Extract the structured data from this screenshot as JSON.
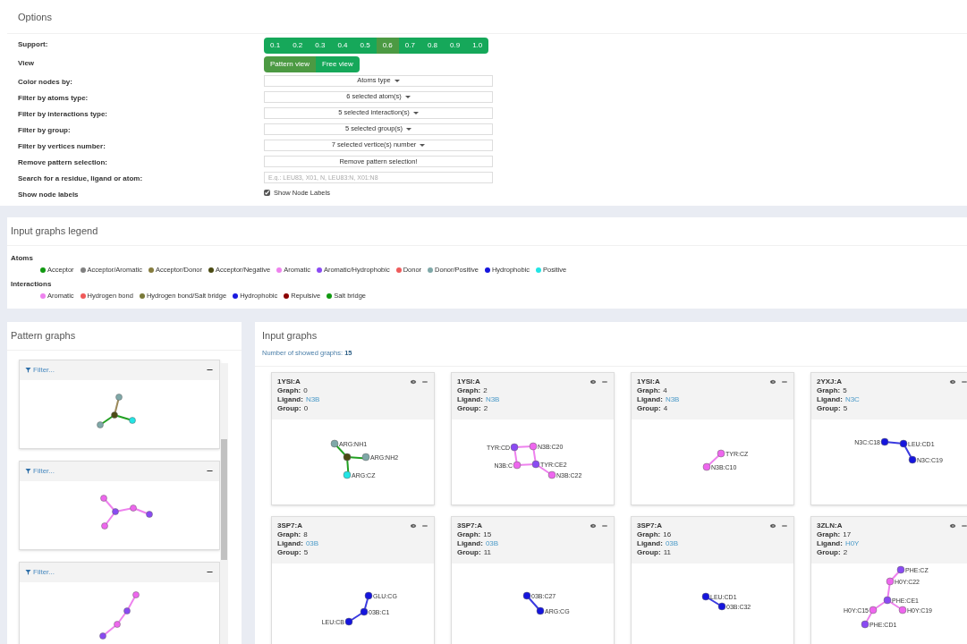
{
  "options": {
    "title": "Options",
    "rows": [
      {
        "label": "Support:",
        "kind": "segmented",
        "choices": [
          {
            "label": "0.1",
            "selected": false
          },
          {
            "label": "0.2",
            "selected": false
          },
          {
            "label": "0.3",
            "selected": false
          },
          {
            "label": "0.4",
            "selected": false
          },
          {
            "label": "0.5",
            "selected": false
          },
          {
            "label": "0.6",
            "selected": true
          },
          {
            "label": "0.7",
            "selected": false
          },
          {
            "label": "0.8",
            "selected": false
          },
          {
            "label": "0.9",
            "selected": false
          },
          {
            "label": "1.0",
            "selected": false
          }
        ]
      },
      {
        "label": "View",
        "kind": "segmented",
        "choices": [
          {
            "label": "Pattern view",
            "selected": true
          },
          {
            "label": "Free view",
            "selected": false
          }
        ]
      },
      {
        "label": "Color nodes by:",
        "kind": "dropdown",
        "value": "Atoms type"
      },
      {
        "label": "Filter by atoms type:",
        "kind": "dropdown",
        "value": "6 selected atom(s)"
      },
      {
        "label": "Filter by interactions type:",
        "kind": "dropdown",
        "value": "5 selected interaction(s)"
      },
      {
        "label": "Filter by group:",
        "kind": "dropdown",
        "value": "5 selected group(s)"
      },
      {
        "label": "Filter by vertices number:",
        "kind": "dropdown",
        "value": "7 selected vertice(s) number"
      },
      {
        "label": "Remove pattern selection:",
        "kind": "button",
        "value": "Remove pattern selection!"
      },
      {
        "label": "Search for a residue, ligand or atom:",
        "kind": "search",
        "placeholder": "E.g.: LEU83, X01, N, LEU83:N, X01:N8"
      },
      {
        "label": "Show node labels",
        "kind": "checkbox",
        "text": "Show Node Labels",
        "checked": true
      }
    ]
  },
  "legend": {
    "title": "Input graphs legend",
    "groups": [
      {
        "title": "Atoms",
        "items": [
          {
            "label": "Acceptor",
            "color": "#119911"
          },
          {
            "label": "Acceptor/Aromatic",
            "color": "#808080"
          },
          {
            "label": "Acceptor/Donor",
            "color": "#857c3e"
          },
          {
            "label": "Acceptor/Negative",
            "color": "#4b4b13"
          },
          {
            "label": "Aromatic",
            "color": "#ee82ee"
          },
          {
            "label": "Aromatic/Hydrophobic",
            "color": "#8a4af3"
          },
          {
            "label": "Donor",
            "color": "#ee5c5c"
          },
          {
            "label": "Donor/Positive",
            "color": "#7fa8a8"
          },
          {
            "label": "Hydrophobic",
            "color": "#1515dd"
          },
          {
            "label": "Positive",
            "color": "#22e5e5"
          }
        ]
      },
      {
        "title": "Interactions",
        "items": [
          {
            "label": "Aromatic",
            "color": "#ee82ee"
          },
          {
            "label": "Hydrogen bond",
            "color": "#f05a5a"
          },
          {
            "label": "Hydrogen bond/Salt bridge",
            "color": "#7a7a3a"
          },
          {
            "label": "Hydrophobic",
            "color": "#1a1ae0"
          },
          {
            "label": "Repulsive",
            "color": "#8b0000"
          },
          {
            "label": "Salt bridge",
            "color": "#119911"
          }
        ]
      }
    ]
  },
  "pattern_graphs": {
    "title": "Pattern graphs",
    "cards": [
      {
        "filter": "Filter...",
        "nodes": [
          {
            "color": "#7fa8a8"
          },
          {
            "color": "#4b4b13"
          },
          {
            "color": "#7fa8a8"
          },
          {
            "color": "#22e5e5"
          }
        ],
        "edges": [
          {
            "color": "#9c8a5a"
          },
          {
            "color": "#22a022"
          },
          {
            "color": "#22a022"
          }
        ]
      },
      {
        "filter": "Filter...",
        "nodes": [
          {
            "color": "#ee66ee"
          },
          {
            "color": "#8a4af3"
          },
          {
            "color": "#ee66ee"
          },
          {
            "color": "#8a4af3"
          },
          {
            "color": "#ee66ee"
          }
        ],
        "edges": [
          {
            "color": "#ee82ee"
          },
          {
            "color": "#ee82ee"
          },
          {
            "color": "#ee82ee"
          },
          {
            "color": "#ee82ee"
          }
        ]
      },
      {
        "filter": "Filter...",
        "nodes": [
          {
            "color": "#ee66ee"
          },
          {
            "color": "#8a4af3"
          },
          {
            "color": "#ee66ee"
          },
          {
            "color": "#8a4af3"
          }
        ],
        "edges": [
          {
            "color": "#ee82ee"
          },
          {
            "color": "#ee82ee"
          },
          {
            "color": "#ee82ee"
          }
        ]
      }
    ]
  },
  "input_graphs": {
    "title": "Input graphs",
    "count_label": "Number of showed graphs:",
    "count": "15",
    "cards": [
      {
        "title": "1YSI:A",
        "fields": [
          {
            "label": "Graph:",
            "value": "0"
          },
          {
            "label": "Ligand:",
            "value": "N3B",
            "kind": "link"
          },
          {
            "label": "Group:",
            "value": "0"
          }
        ],
        "nodes": [
          {
            "label": "ARG:NH1",
            "color": "#7fa8a8"
          },
          {
            "color": "#4b4b13"
          },
          {
            "label": "ARG:NH2",
            "color": "#7fa8a8"
          },
          {
            "label": "ARG:CZ",
            "color": "#22e5e5"
          }
        ],
        "edges": [
          {
            "color": "#22a022"
          },
          {
            "color": "#22a022"
          },
          {
            "color": "#22a022"
          }
        ]
      },
      {
        "title": "1YSI:A",
        "fields": [
          {
            "label": "Graph:",
            "value": "2"
          },
          {
            "label": "Ligand:",
            "value": "N3B",
            "kind": "link"
          },
          {
            "label": "Group:",
            "value": "2"
          }
        ],
        "nodes": [
          {
            "label": "TYR:CD",
            "color": "#8a4af3"
          },
          {
            "label": "N3B:C20",
            "color": "#ee66ee"
          },
          {
            "label": "N3B:C",
            "color": "#ee66ee"
          },
          {
            "label": "TYR:CE2",
            "color": "#8a4af3"
          },
          {
            "label": "N3B:C22",
            "color": "#ee66ee"
          }
        ],
        "edges": [
          {
            "color": "#ee82ee"
          },
          {
            "color": "#ee82ee"
          },
          {
            "color": "#ee82ee"
          },
          {
            "color": "#ee82ee"
          },
          {
            "color": "#ee82ee"
          }
        ]
      },
      {
        "title": "1YSI:A",
        "fields": [
          {
            "label": "Graph:",
            "value": "4"
          },
          {
            "label": "Ligand:",
            "value": "N3B",
            "kind": "link"
          },
          {
            "label": "Group:",
            "value": "4"
          }
        ],
        "nodes": [
          {
            "label": "TYR:CZ",
            "color": "#ee66ee"
          },
          {
            "label": "N3B:C10",
            "color": "#ee66ee"
          }
        ],
        "edges": [
          {
            "color": "#ee82ee"
          }
        ]
      },
      {
        "title": "2YXJ:A",
        "fields": [
          {
            "label": "Graph:",
            "value": "5"
          },
          {
            "label": "Ligand:",
            "value": "N3C",
            "kind": "link"
          },
          {
            "label": "Group:",
            "value": "5"
          }
        ],
        "nodes": [
          {
            "label": "N3C:C18",
            "color": "#1515dd"
          },
          {
            "label": "LEU:CD1",
            "color": "#1515dd"
          },
          {
            "label": "N3C:C19",
            "color": "#1515dd"
          }
        ],
        "edges": [
          {
            "color": "#3a3ae0"
          },
          {
            "color": "#3a3ae0"
          }
        ]
      },
      {
        "title": "3SP7:A",
        "fields": [
          {
            "label": "Graph:",
            "value": "8"
          },
          {
            "label": "Ligand:",
            "value": "03B",
            "kind": "link"
          },
          {
            "label": "Group:",
            "value": "5"
          }
        ],
        "nodes": [
          {
            "label": "GLU:CG",
            "color": "#1515dd"
          },
          {
            "label": "03B:C1",
            "color": "#1515dd"
          },
          {
            "label": "LEU:CB",
            "color": "#1515dd"
          }
        ],
        "edges": [
          {
            "color": "#3a3ae0"
          },
          {
            "color": "#3a3ae0"
          }
        ]
      },
      {
        "title": "3SP7:A",
        "fields": [
          {
            "label": "Graph:",
            "value": "15"
          },
          {
            "label": "Ligand:",
            "value": "03B",
            "kind": "link"
          },
          {
            "label": "Group:",
            "value": "11"
          }
        ],
        "nodes": [
          {
            "label": "03B:C27",
            "color": "#1515dd"
          },
          {
            "label": "ARG:CG",
            "color": "#1515dd"
          }
        ],
        "edges": [
          {
            "color": "#3a3ae0"
          }
        ]
      },
      {
        "title": "3SP7:A",
        "fields": [
          {
            "label": "Graph:",
            "value": "16"
          },
          {
            "label": "Ligand:",
            "value": "03B",
            "kind": "link"
          },
          {
            "label": "Group:",
            "value": "11"
          }
        ],
        "nodes": [
          {
            "label": "LEU:CD1",
            "color": "#1515dd"
          },
          {
            "label": "03B:C32",
            "color": "#1515dd"
          }
        ],
        "edges": [
          {
            "color": "#3a3ae0"
          }
        ]
      },
      {
        "title": "3ZLN:A",
        "fields": [
          {
            "label": "Graph:",
            "value": "17"
          },
          {
            "label": "Ligand:",
            "value": "H0Y",
            "kind": "link"
          },
          {
            "label": "Group:",
            "value": "2"
          }
        ],
        "nodes": [
          {
            "label": "PHE:CZ",
            "color": "#8a4af3"
          },
          {
            "label": "H0Y:C22",
            "color": "#ee66ee"
          },
          {
            "label": "PHE:CE1",
            "color": "#8a4af3"
          },
          {
            "label": "H0Y:C15",
            "color": "#ee66ee"
          },
          {
            "label": "H0Y:C19",
            "color": "#ee66ee"
          },
          {
            "label": "PHE:CD1",
            "color": "#8a4af3"
          }
        ],
        "edges": [
          {
            "color": "#ee82ee"
          },
          {
            "color": "#ee82ee"
          },
          {
            "color": "#ee82ee"
          },
          {
            "color": "#ee82ee"
          },
          {
            "color": "#ee82ee"
          }
        ]
      }
    ]
  }
}
